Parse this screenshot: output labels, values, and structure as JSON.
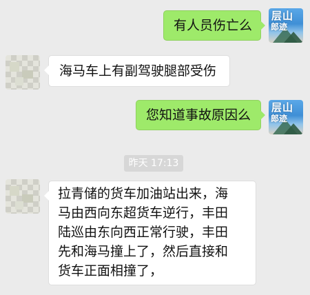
{
  "messages": [
    {
      "sender": "self",
      "text": "有人员伤亡么"
    },
    {
      "sender": "other",
      "text": "海马车上有副驾驶腿部受伤"
    },
    {
      "sender": "self",
      "text": "您知道事故原因么"
    },
    {
      "sender": "other",
      "lines": [
        "拉青储的货车加油站出来，海",
        "马由西向东超货车逆行，丰田",
        "陆巡由东向西正常行驶，丰田",
        "先和海马撞上了，然后直接和",
        "货车正面相撞了，"
      ]
    }
  ],
  "timestamp": "昨天 17:13",
  "self_avatar": {
    "brush_text_top": "层山",
    "brush_text_bottom": "郎迹"
  },
  "colors": {
    "background": "#ebebeb",
    "self_bubble": "#9eea6a",
    "other_bubble": "#ffffff",
    "timestamp_bg": "#d7d7d7"
  }
}
